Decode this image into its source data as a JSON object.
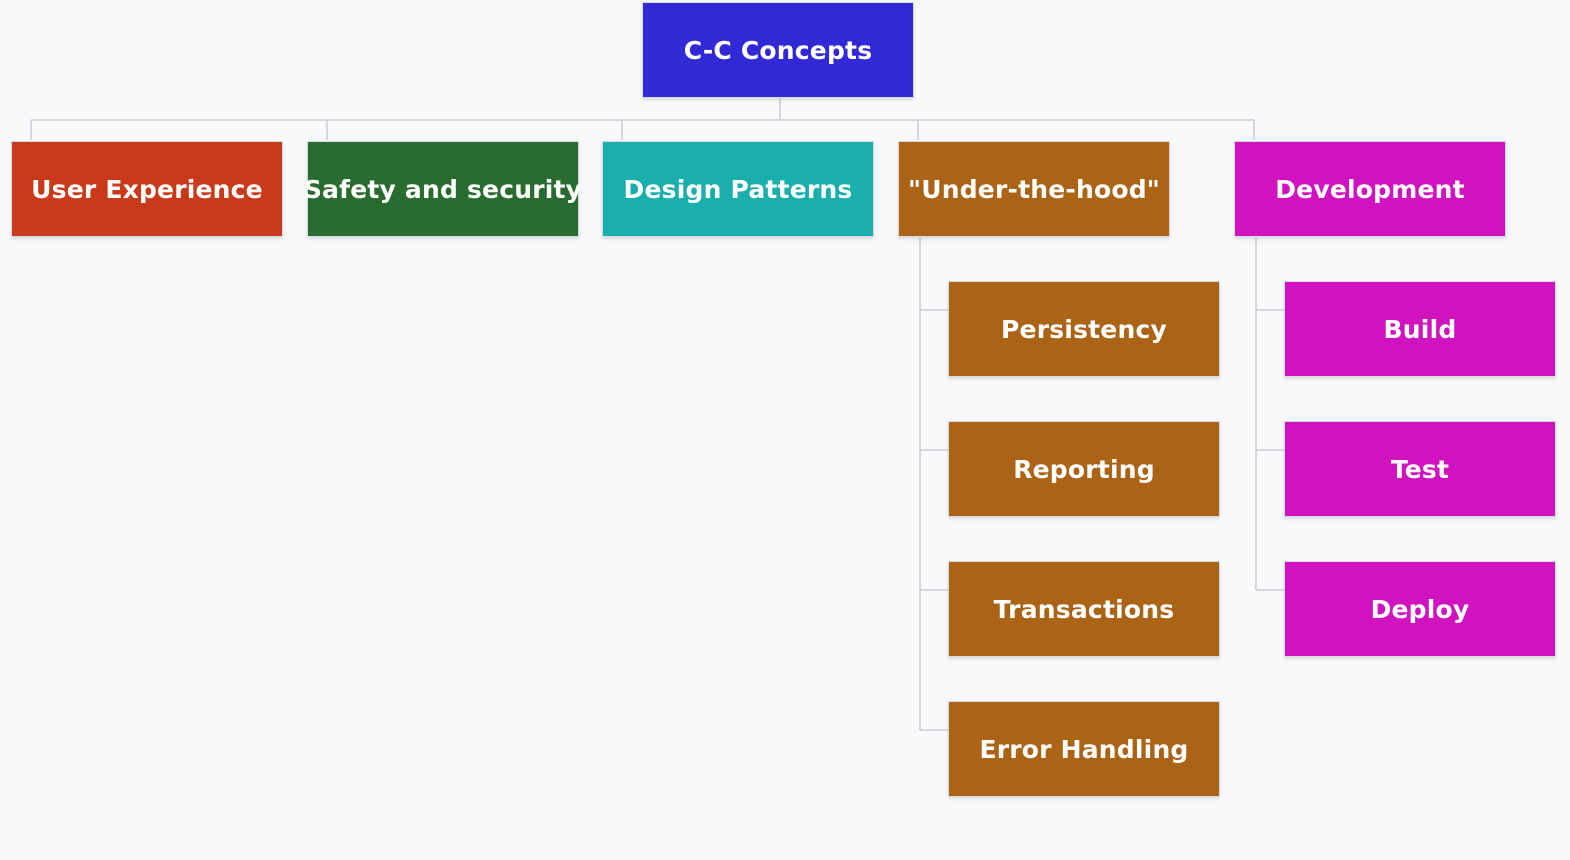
{
  "root": {
    "label": "C-C Concepts",
    "color": "#3229d6"
  },
  "categories": [
    {
      "id": "ux",
      "label": "User Experience",
      "color": "#c93a1b"
    },
    {
      "id": "security",
      "label": "Safety and security",
      "color": "#2a6b30"
    },
    {
      "id": "patterns",
      "label": "Design Patterns",
      "color": "#1aafad"
    },
    {
      "id": "underhood",
      "label": "\"Under-the-hood\"",
      "color": "#ab6416",
      "children": [
        {
          "label": "Persistency"
        },
        {
          "label": "Reporting"
        },
        {
          "label": "Transactions"
        },
        {
          "label": "Error Handling"
        }
      ]
    },
    {
      "id": "development",
      "label": "Development",
      "color": "#d013bf",
      "children": [
        {
          "label": "Build"
        },
        {
          "label": "Test"
        },
        {
          "label": "Deploy"
        }
      ]
    }
  ]
}
